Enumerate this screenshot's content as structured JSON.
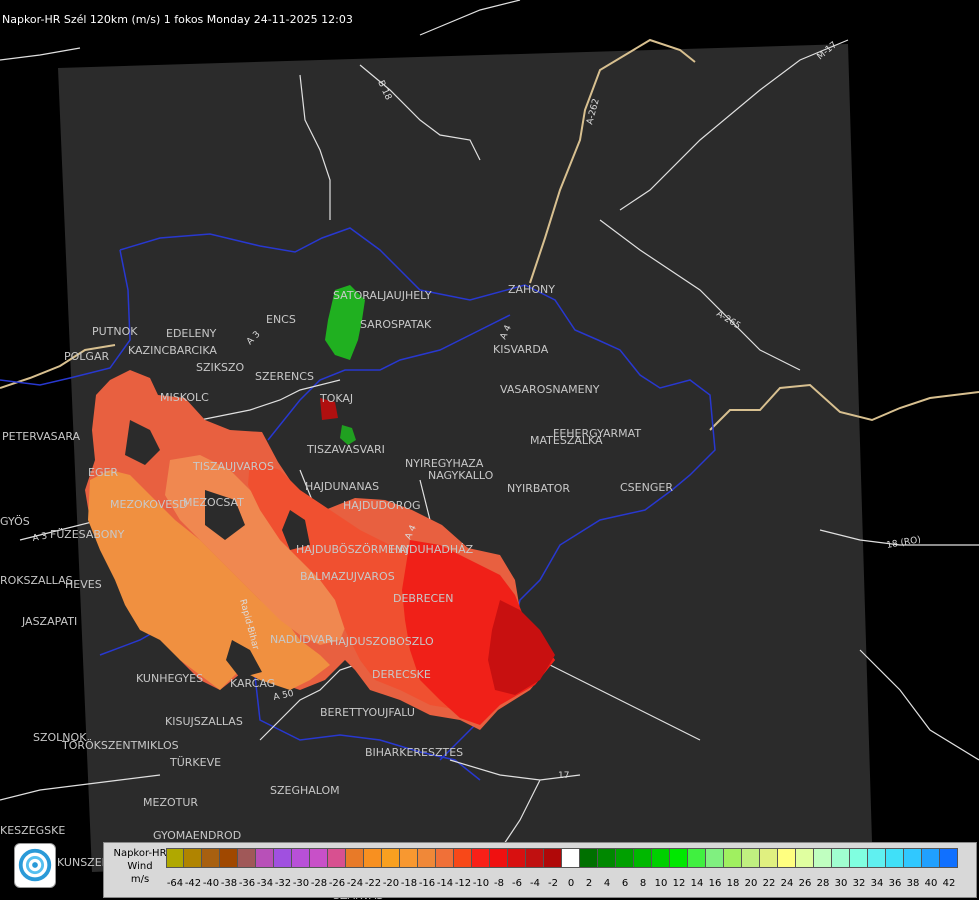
{
  "header": {
    "title": "Napkor-HR Szél 120km (m/s) 1 fokos Monday 24-11-2025 12:03"
  },
  "legend": {
    "title_lines": [
      "Napkor-HR",
      "Wind",
      "m/s"
    ],
    "colors": [
      "#b0a800",
      "#b08400",
      "#a86010",
      "#a04800",
      "#a05858",
      "#b850b8",
      "#a050e0",
      "#b850d8",
      "#c850c8",
      "#d85090",
      "#e87a28",
      "#f89020",
      "#f8a020",
      "#f89830",
      "#f08838",
      "#f07038",
      "#f84818",
      "#f82018",
      "#f01010",
      "#d81010",
      "#c01010",
      "#b00808",
      "#ffffff",
      "#007000",
      "#008800",
      "#00a000",
      "#00b800",
      "#00d000",
      "#00e800",
      "#40f040",
      "#80f080",
      "#a0f060",
      "#c0f080",
      "#e0f080",
      "#ffff80",
      "#e0ffa0",
      "#c0ffc0",
      "#a0ffd0",
      "#80ffe0",
      "#60f0f0",
      "#40e0f8",
      "#30c8ff",
      "#20a0ff",
      "#1070ff",
      "#0040ff",
      "#0010e8"
    ],
    "labels": [
      "-64",
      "-42",
      "-40",
      "-38",
      "-36",
      "-34",
      "-32",
      "-30",
      "-28",
      "-26",
      "-24",
      "-22",
      "-20",
      "-18",
      "-16",
      "-14",
      "-12",
      "-10",
      "-8",
      "-6",
      "-4",
      "-2",
      "0",
      "2",
      "4",
      "6",
      "8",
      "10",
      "12",
      "14",
      "16",
      "18",
      "20",
      "22",
      "24",
      "26",
      "28",
      "30",
      "32",
      "34",
      "36",
      "38",
      "40",
      "42"
    ]
  },
  "cities": [
    {
      "name": "SATORALJAUJHELY"
    },
    {
      "name": "SAROSPATAK"
    },
    {
      "name": "ZAHONY"
    },
    {
      "name": "KISVARDA"
    },
    {
      "name": "PUTNOK"
    },
    {
      "name": "EDELENY"
    },
    {
      "name": "KAZINCBARCIKA"
    },
    {
      "name": "ENCS"
    },
    {
      "name": "SZIKSZO"
    },
    {
      "name": "SZERENCS"
    },
    {
      "name": "TOKAJ"
    },
    {
      "name": "MISKOLC"
    },
    {
      "name": "VASAROSNAMENY"
    },
    {
      "name": "FEHERGYARMAT"
    },
    {
      "name": "MATESZALKA"
    },
    {
      "name": "PETERVASARA"
    },
    {
      "name": "TISZAVASVARI"
    },
    {
      "name": "NYIREGYHAZA"
    },
    {
      "name": "NAGYKALLO"
    },
    {
      "name": "TISZAUJVAROS"
    },
    {
      "name": "EGER"
    },
    {
      "name": "MEZOKOVESD"
    },
    {
      "name": "HAJDUNANAS"
    },
    {
      "name": "NYIRBATOR"
    },
    {
      "name": "CSENGER"
    },
    {
      "name": "HAJDUDOROG"
    },
    {
      "name": "MEZOCSAT"
    },
    {
      "name": "GYÖS"
    },
    {
      "name": "FÜZESABONY"
    },
    {
      "name": "HAJDUBÖSZÖRMENY"
    },
    {
      "name": "HAJDUHADHÁZ"
    },
    {
      "name": "BALMAZUJVAROS"
    },
    {
      "name": "HEVES"
    },
    {
      "name": "ROKSZALLAS"
    },
    {
      "name": "DEBRECEN"
    },
    {
      "name": "JASZAPATI"
    },
    {
      "name": "NADUDVAR"
    },
    {
      "name": "HAJDUSZOBOSZLO"
    },
    {
      "name": "KUNHEGYES"
    },
    {
      "name": "KARCAG"
    },
    {
      "name": "DERECSKE"
    },
    {
      "name": "BERETTYOUJFALU"
    },
    {
      "name": "KISUJSZALLAS"
    },
    {
      "name": "SZOLNOK"
    },
    {
      "name": "TÖRÖKSZENTMIKLOS"
    },
    {
      "name": "BIHARKERESZTES"
    },
    {
      "name": "TÜRKEVE"
    },
    {
      "name": "SZEGHALOM"
    },
    {
      "name": "MEZOTUR"
    },
    {
      "name": "KESZEGSKE"
    },
    {
      "name": "GYOMAENDROD"
    },
    {
      "name": "KUNSZENTMARTON"
    },
    {
      "name": "SZARVAS"
    },
    {
      "name": "POLGAR"
    }
  ],
  "roads": [
    {
      "name": "B 18"
    },
    {
      "name": "A-262"
    },
    {
      "name": "M-17"
    },
    {
      "name": "A-265"
    },
    {
      "name": "18 (RO)"
    },
    {
      "name": "A 3"
    },
    {
      "name": "A 3"
    },
    {
      "name": "Rapid-Bihar"
    },
    {
      "name": "A 4"
    },
    {
      "name": "A 4"
    },
    {
      "name": "A 50"
    },
    {
      "name": "17"
    }
  ]
}
